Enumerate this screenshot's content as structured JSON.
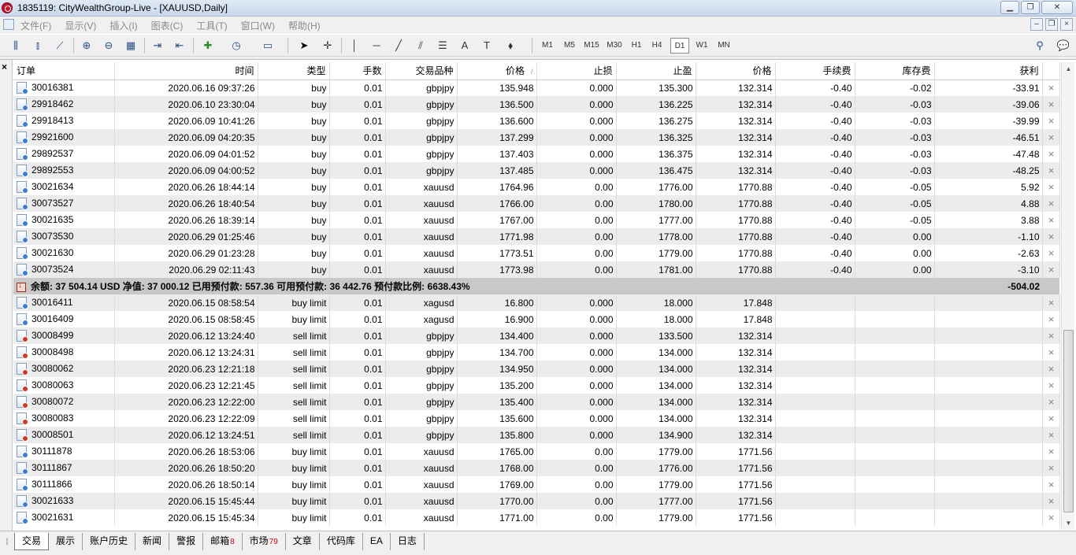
{
  "window": {
    "title": "1835119: CityWealthGroup-Live - [XAUUSD,Daily]",
    "controls": [
      "▁",
      "❐",
      "✕"
    ]
  },
  "menu": {
    "items": [
      "文件(F)",
      "显示(V)",
      "插入(I)",
      "图表(C)",
      "工具(T)",
      "窗口(W)",
      "帮助(H)"
    ],
    "mdi_controls": [
      "–",
      "❐",
      "×"
    ]
  },
  "toolbar": {
    "timeframes": [
      "M1",
      "M5",
      "M15",
      "M30",
      "H1",
      "H4",
      "D1",
      "W1",
      "MN"
    ],
    "active_timeframe": "D1",
    "text_tool": "A",
    "label_tool": "T"
  },
  "table": {
    "headers": [
      "订单",
      "时间",
      "类型",
      "手数",
      "交易品种",
      "价格",
      "止损",
      "止盈",
      "价格",
      "手续费",
      "库存费",
      "获利"
    ],
    "sort_mark": "/",
    "open_orders": [
      {
        "ticket": "30016381",
        "time": "2020.06.16 09:37:26",
        "type": "buy",
        "lots": "0.01",
        "symbol": "gbpjpy",
        "price": "135.948",
        "sl": "0.000",
        "tp": "135.300",
        "cur": "132.314",
        "comm": "-0.40",
        "swap": "-0.02",
        "profit": "-33.91"
      },
      {
        "ticket": "29918462",
        "time": "2020.06.10 23:30:04",
        "type": "buy",
        "lots": "0.01",
        "symbol": "gbpjpy",
        "price": "136.500",
        "sl": "0.000",
        "tp": "136.225",
        "cur": "132.314",
        "comm": "-0.40",
        "swap": "-0.03",
        "profit": "-39.06"
      },
      {
        "ticket": "29918413",
        "time": "2020.06.09 10:41:26",
        "type": "buy",
        "lots": "0.01",
        "symbol": "gbpjpy",
        "price": "136.600",
        "sl": "0.000",
        "tp": "136.275",
        "cur": "132.314",
        "comm": "-0.40",
        "swap": "-0.03",
        "profit": "-39.99"
      },
      {
        "ticket": "29921600",
        "time": "2020.06.09 04:20:35",
        "type": "buy",
        "lots": "0.01",
        "symbol": "gbpjpy",
        "price": "137.299",
        "sl": "0.000",
        "tp": "136.325",
        "cur": "132.314",
        "comm": "-0.40",
        "swap": "-0.03",
        "profit": "-46.51"
      },
      {
        "ticket": "29892537",
        "time": "2020.06.09 04:01:52",
        "type": "buy",
        "lots": "0.01",
        "symbol": "gbpjpy",
        "price": "137.403",
        "sl": "0.000",
        "tp": "136.375",
        "cur": "132.314",
        "comm": "-0.40",
        "swap": "-0.03",
        "profit": "-47.48"
      },
      {
        "ticket": "29892553",
        "time": "2020.06.09 04:00:52",
        "type": "buy",
        "lots": "0.01",
        "symbol": "gbpjpy",
        "price": "137.485",
        "sl": "0.000",
        "tp": "136.475",
        "cur": "132.314",
        "comm": "-0.40",
        "swap": "-0.03",
        "profit": "-48.25"
      },
      {
        "ticket": "30021634",
        "time": "2020.06.26 18:44:14",
        "type": "buy",
        "lots": "0.01",
        "symbol": "xauusd",
        "price": "1764.96",
        "sl": "0.00",
        "tp": "1776.00",
        "cur": "1770.88",
        "comm": "-0.40",
        "swap": "-0.05",
        "profit": "5.92"
      },
      {
        "ticket": "30073527",
        "time": "2020.06.26 18:40:54",
        "type": "buy",
        "lots": "0.01",
        "symbol": "xauusd",
        "price": "1766.00",
        "sl": "0.00",
        "tp": "1780.00",
        "cur": "1770.88",
        "comm": "-0.40",
        "swap": "-0.05",
        "profit": "4.88"
      },
      {
        "ticket": "30021635",
        "time": "2020.06.26 18:39:14",
        "type": "buy",
        "lots": "0.01",
        "symbol": "xauusd",
        "price": "1767.00",
        "sl": "0.00",
        "tp": "1777.00",
        "cur": "1770.88",
        "comm": "-0.40",
        "swap": "-0.05",
        "profit": "3.88"
      },
      {
        "ticket": "30073530",
        "time": "2020.06.29 01:25:46",
        "type": "buy",
        "lots": "0.01",
        "symbol": "xauusd",
        "price": "1771.98",
        "sl": "0.00",
        "tp": "1778.00",
        "cur": "1770.88",
        "comm": "-0.40",
        "swap": "0.00",
        "profit": "-1.10"
      },
      {
        "ticket": "30021630",
        "time": "2020.06.29 01:23:28",
        "type": "buy",
        "lots": "0.01",
        "symbol": "xauusd",
        "price": "1773.51",
        "sl": "0.00",
        "tp": "1779.00",
        "cur": "1770.88",
        "comm": "-0.40",
        "swap": "0.00",
        "profit": "-2.63"
      },
      {
        "ticket": "30073524",
        "time": "2020.06.29 02:11:43",
        "type": "buy",
        "lots": "0.01",
        "symbol": "xauusd",
        "price": "1773.98",
        "sl": "0.00",
        "tp": "1781.00",
        "cur": "1770.88",
        "comm": "-0.40",
        "swap": "0.00",
        "profit": "-3.10"
      }
    ],
    "summary": {
      "text": "余额: 37 504.14 USD  净值: 37 000.12  已用预付款: 557.36  可用预付款: 36 442.76  预付款比例: 6638.43%",
      "profit": "-504.02"
    },
    "pending_orders": [
      {
        "ticket": "30016411",
        "time": "2020.06.15 08:58:54",
        "type": "buy limit",
        "lots": "0.01",
        "symbol": "xagusd",
        "price": "16.800",
        "sl": "0.000",
        "tp": "18.000",
        "cur": "17.848",
        "side": "buy"
      },
      {
        "ticket": "30016409",
        "time": "2020.06.15 08:58:45",
        "type": "buy limit",
        "lots": "0.01",
        "symbol": "xagusd",
        "price": "16.900",
        "sl": "0.000",
        "tp": "18.000",
        "cur": "17.848",
        "side": "buy"
      },
      {
        "ticket": "30008499",
        "time": "2020.06.12 13:24:40",
        "type": "sell limit",
        "lots": "0.01",
        "symbol": "gbpjpy",
        "price": "134.400",
        "sl": "0.000",
        "tp": "133.500",
        "cur": "132.314",
        "side": "sell"
      },
      {
        "ticket": "30008498",
        "time": "2020.06.12 13:24:31",
        "type": "sell limit",
        "lots": "0.01",
        "symbol": "gbpjpy",
        "price": "134.700",
        "sl": "0.000",
        "tp": "134.000",
        "cur": "132.314",
        "side": "sell"
      },
      {
        "ticket": "30080062",
        "time": "2020.06.23 12:21:18",
        "type": "sell limit",
        "lots": "0.01",
        "symbol": "gbpjpy",
        "price": "134.950",
        "sl": "0.000",
        "tp": "134.000",
        "cur": "132.314",
        "side": "sell"
      },
      {
        "ticket": "30080063",
        "time": "2020.06.23 12:21:45",
        "type": "sell limit",
        "lots": "0.01",
        "symbol": "gbpjpy",
        "price": "135.200",
        "sl": "0.000",
        "tp": "134.000",
        "cur": "132.314",
        "side": "sell"
      },
      {
        "ticket": "30080072",
        "time": "2020.06.23 12:22:00",
        "type": "sell limit",
        "lots": "0.01",
        "symbol": "gbpjpy",
        "price": "135.400",
        "sl": "0.000",
        "tp": "134.000",
        "cur": "132.314",
        "side": "sell"
      },
      {
        "ticket": "30080083",
        "time": "2020.06.23 12:22:09",
        "type": "sell limit",
        "lots": "0.01",
        "symbol": "gbpjpy",
        "price": "135.600",
        "sl": "0.000",
        "tp": "134.000",
        "cur": "132.314",
        "side": "sell"
      },
      {
        "ticket": "30008501",
        "time": "2020.06.12 13:24:51",
        "type": "sell limit",
        "lots": "0.01",
        "symbol": "gbpjpy",
        "price": "135.800",
        "sl": "0.000",
        "tp": "134.900",
        "cur": "132.314",
        "side": "sell"
      },
      {
        "ticket": "30111878",
        "time": "2020.06.26 18:53:06",
        "type": "buy limit",
        "lots": "0.01",
        "symbol": "xauusd",
        "price": "1765.00",
        "sl": "0.00",
        "tp": "1779.00",
        "cur": "1771.56",
        "side": "buy"
      },
      {
        "ticket": "30111867",
        "time": "2020.06.26 18:50:20",
        "type": "buy limit",
        "lots": "0.01",
        "symbol": "xauusd",
        "price": "1768.00",
        "sl": "0.00",
        "tp": "1776.00",
        "cur": "1771.56",
        "side": "buy"
      },
      {
        "ticket": "30111866",
        "time": "2020.06.26 18:50:14",
        "type": "buy limit",
        "lots": "0.01",
        "symbol": "xauusd",
        "price": "1769.00",
        "sl": "0.00",
        "tp": "1779.00",
        "cur": "1771.56",
        "side": "buy"
      },
      {
        "ticket": "30021633",
        "time": "2020.06.15 15:45:44",
        "type": "buy limit",
        "lots": "0.01",
        "symbol": "xauusd",
        "price": "1770.00",
        "sl": "0.00",
        "tp": "1777.00",
        "cur": "1771.56",
        "side": "buy"
      },
      {
        "ticket": "30021631",
        "time": "2020.06.15 15:45:34",
        "type": "buy limit",
        "lots": "0.01",
        "symbol": "xauusd",
        "price": "1771.00",
        "sl": "0.00",
        "tp": "1779.00",
        "cur": "1771.56",
        "side": "buy"
      }
    ]
  },
  "tabs": {
    "items": [
      {
        "label": "交易",
        "badge": ""
      },
      {
        "label": "展示",
        "badge": ""
      },
      {
        "label": "账户历史",
        "badge": ""
      },
      {
        "label": "新闻",
        "badge": ""
      },
      {
        "label": "警报",
        "badge": ""
      },
      {
        "label": "邮箱",
        "badge": "8"
      },
      {
        "label": "市场",
        "badge": "79"
      },
      {
        "label": "文章",
        "badge": ""
      },
      {
        "label": "代码库",
        "badge": ""
      },
      {
        "label": "EA",
        "badge": ""
      },
      {
        "label": "日志",
        "badge": ""
      }
    ],
    "active": "交易"
  },
  "colors": {
    "accent": "#2a4f86",
    "badge": "#d0021b",
    "summary_bg": "#c8c8c8",
    "row_alt": "#ececec"
  }
}
